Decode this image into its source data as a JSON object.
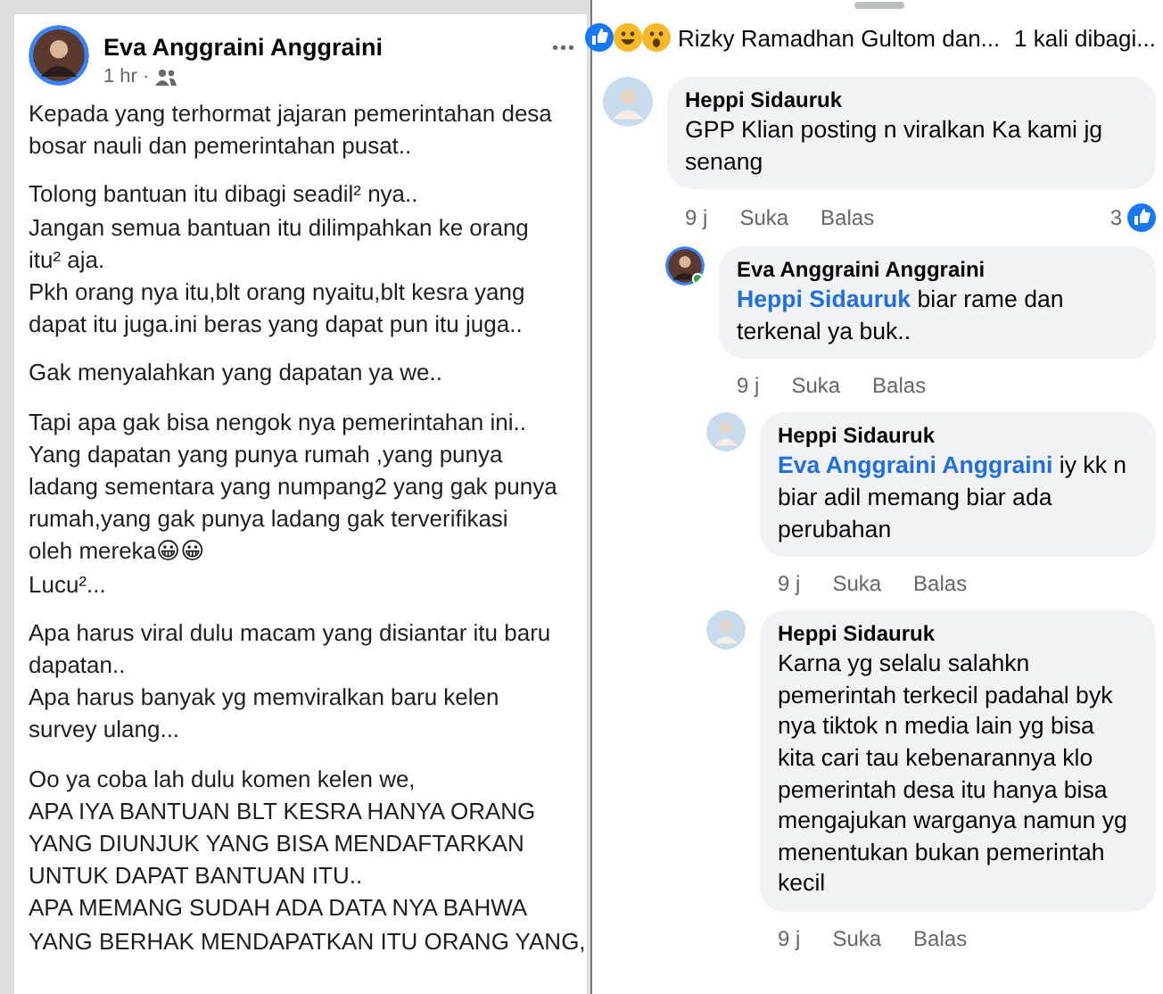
{
  "post": {
    "author": "Eva Anggraini Anggraini",
    "time": "1 hr ·",
    "menu": "•••",
    "paragraphs": [
      [
        "Kepada yang terhormat jajaran pemerintahan desa",
        "bosar nauli dan pemerintahan pusat.."
      ],
      [
        "Tolong bantuan itu dibagi seadil² nya..",
        "Jangan semua bantuan itu dilimpahkan ke orang",
        "itu² aja.",
        "Pkh orang nya itu,blt orang nyaitu,blt kesra yang",
        "dapat itu juga.ini beras yang dapat pun itu juga.."
      ],
      [
        "Gak menyalahkan yang dapatan ya we.."
      ],
      [
        "Tapi apa gak bisa nengok nya pemerintahan ini..",
        "Yang dapatan yang punya rumah ,yang punya",
        "ladang sementara yang numpang2 yang gak punya",
        "rumah,yang gak punya ladang gak terverifikasi",
        "oleh mereka😀😀",
        "Lucu²..."
      ],
      [
        "Apa harus viral dulu macam yang disiantar itu baru",
        "dapatan..",
        "Apa harus banyak yg memviralkan baru kelen",
        "survey ulang..."
      ],
      [
        "Oo ya coba lah dulu komen kelen we,",
        "APA IYA BANTUAN BLT KESRA HANYA ORANG",
        "YANG DIUNJUK YANG BISA MENDAFTARKAN",
        "UNTUK DAPAT BANTUAN ITU..",
        "APA MEMANG SUDAH ADA DATA NYA BAHWA",
        "YANG BERHAK MENDAPATKAN ITU ORANG YANG,"
      ]
    ]
  },
  "reactions": {
    "names": "Rizky Ramadhan Gultom dan...",
    "shares": "1 kali dibagi..."
  },
  "comments": [
    {
      "author": "Heppi Sidauruk",
      "text": "GPP Klian posting n viralkan Ka kami jg senang",
      "time": "9 j",
      "like": "Suka",
      "reply": "Balas",
      "likes": "3",
      "children": [
        {
          "author": "Eva Anggraini Anggraini",
          "online": true,
          "mention": "Heppi Sidauruk",
          "text": "biar rame dan terkenal ya buk..",
          "time": "9 j",
          "like": "Suka",
          "reply": "Balas",
          "children": [
            {
              "author": "Heppi Sidauruk",
              "mention": "Eva Anggraini Anggraini",
              "text": "iy kk n biar adil memang biar ada perubahan",
              "time": "9 j",
              "like": "Suka",
              "reply": "Balas"
            },
            {
              "author": "Heppi Sidauruk",
              "text": "Karna yg selalu salahkn pemerintah terkecil padahal byk nya tiktok n media lain yg bisa kita cari tau kebenarannya klo pemerintah desa itu hanya bisa mengajukan warganya namun yg menentukan bukan pemerintah kecil",
              "time": "9 j",
              "like": "Suka",
              "reply": "Balas"
            }
          ]
        }
      ]
    }
  ]
}
